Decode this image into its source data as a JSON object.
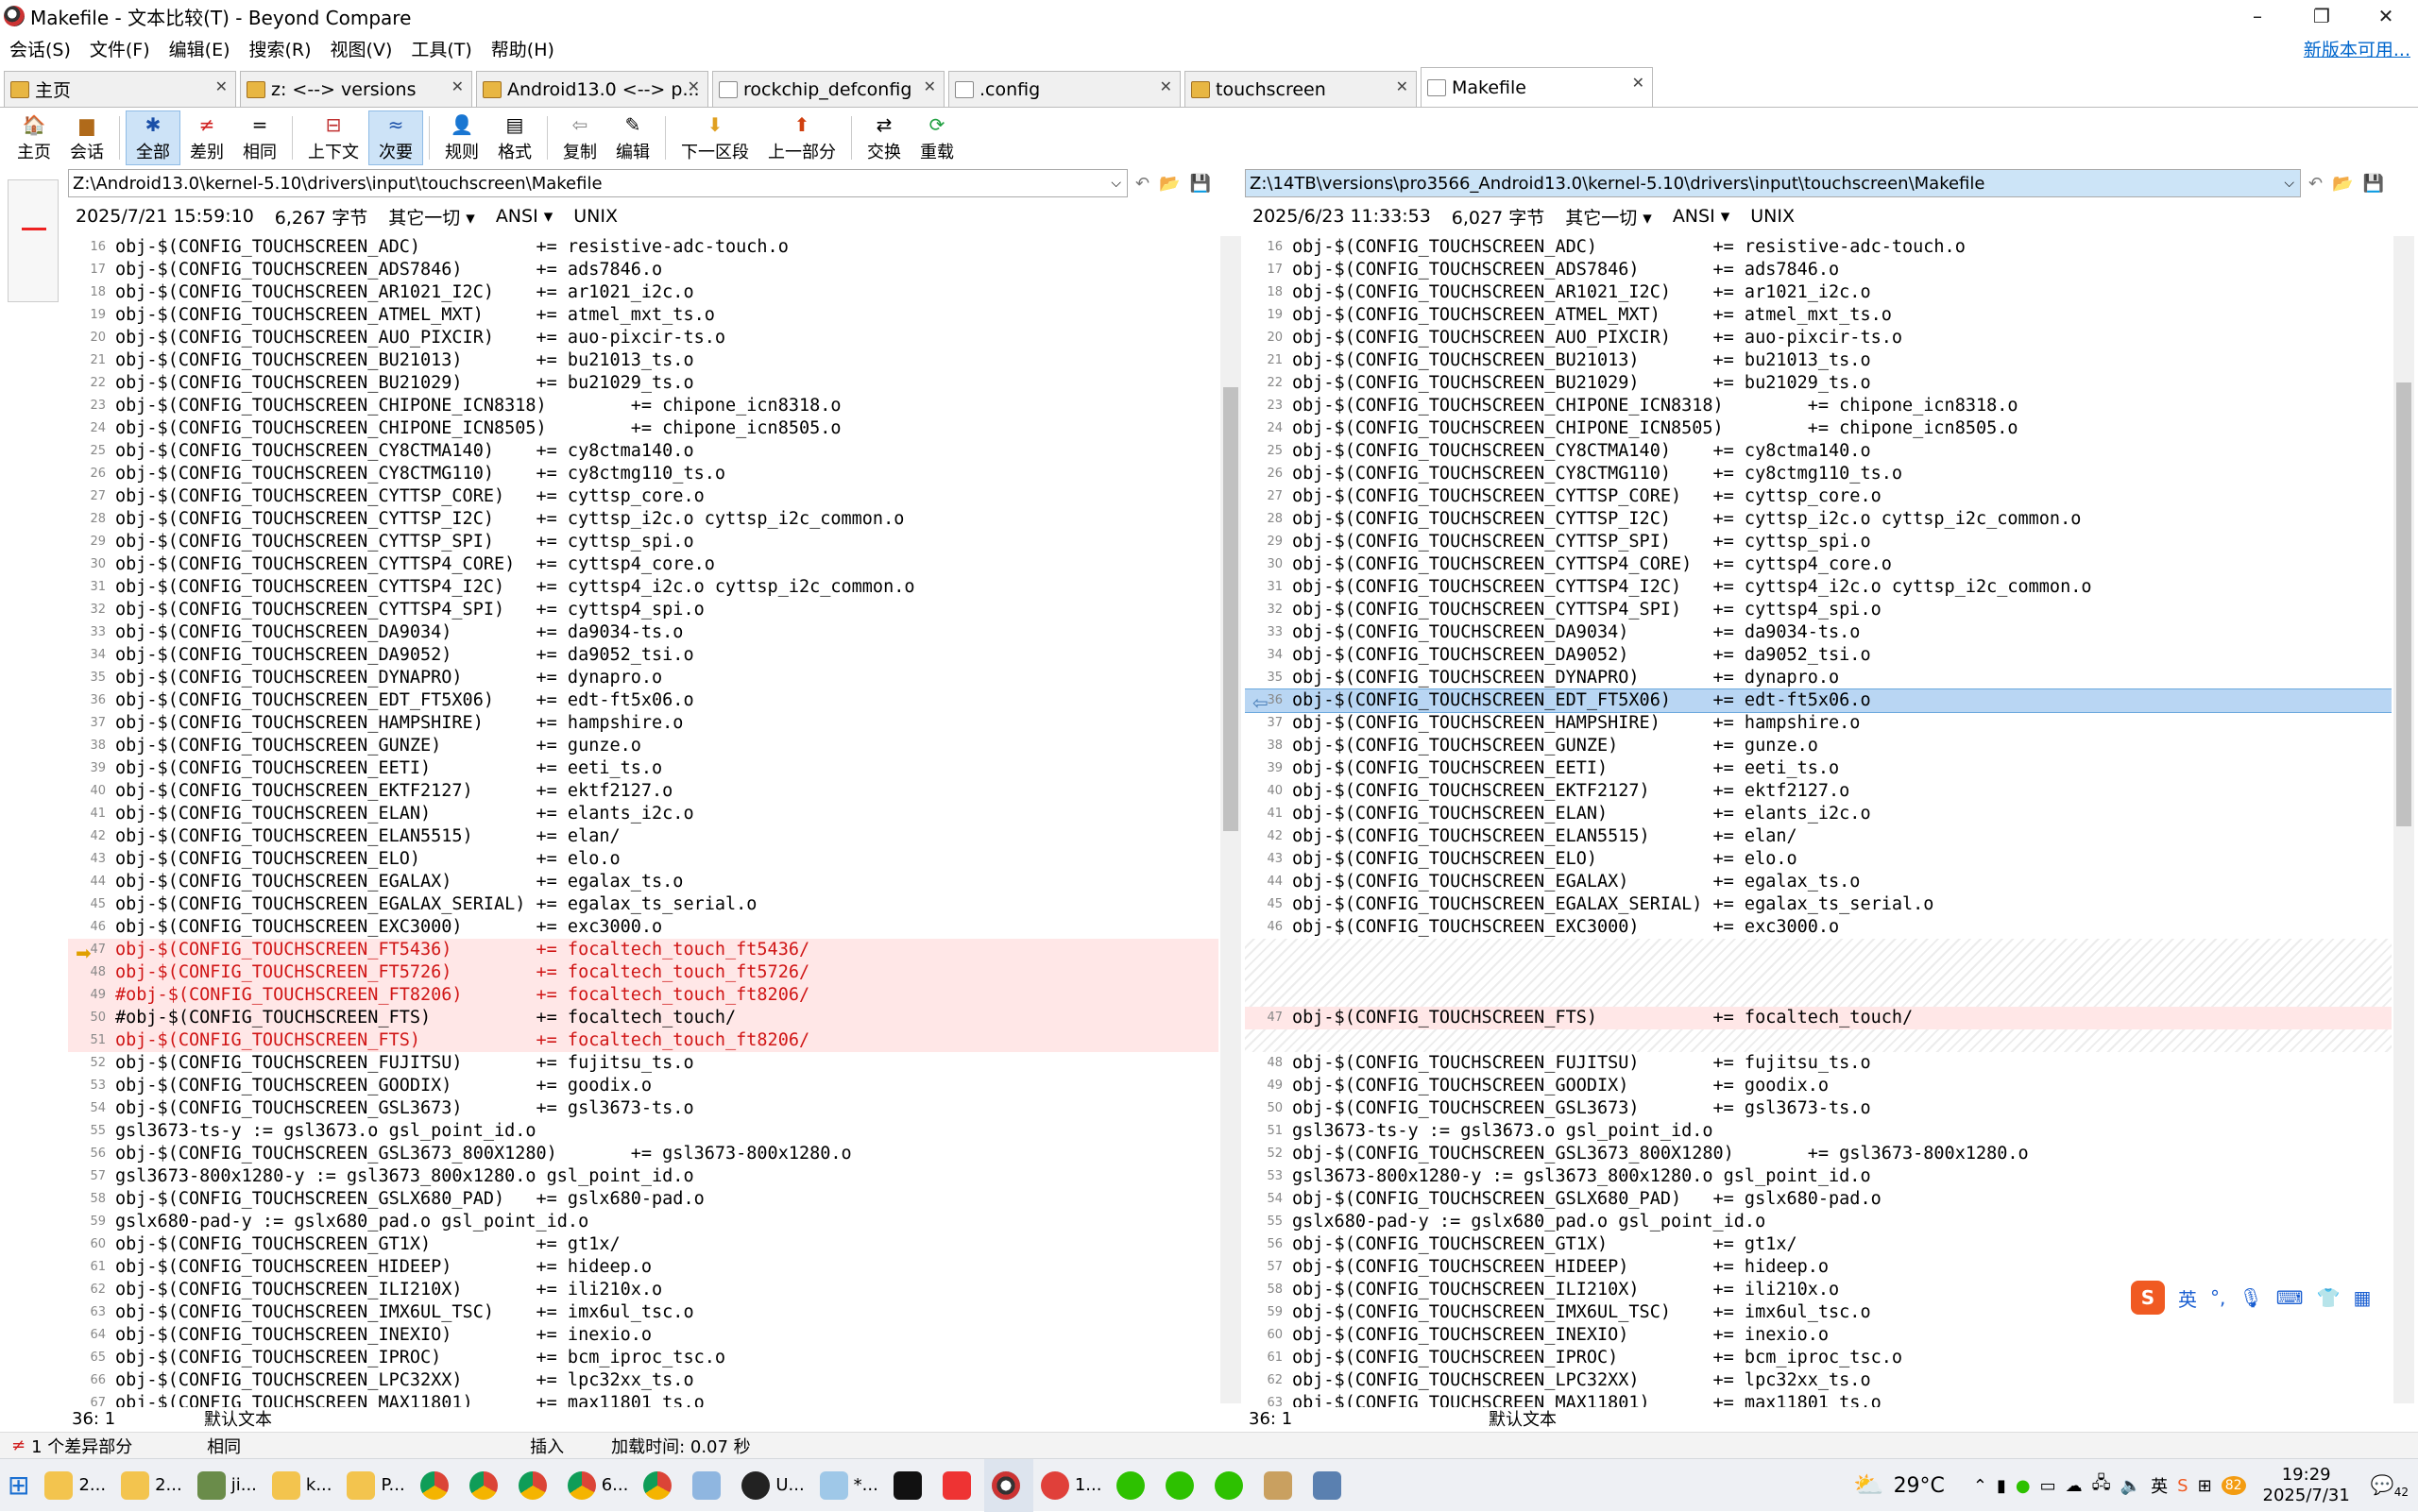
{
  "window": {
    "title": "Makefile - 文本比较(T) - Beyond Compare",
    "min": "–",
    "max": "❐",
    "close": "✕"
  },
  "menu": [
    "会话(S)",
    "文件(F)",
    "编辑(E)",
    "搜索(R)",
    "视图(V)",
    "工具(T)",
    "帮助(H)"
  ],
  "update_link": "新版本可用...",
  "tabs": [
    {
      "label": "主页"
    },
    {
      "label": "z: <--> versions"
    },
    {
      "label": "Android13.0 <--> p..."
    },
    {
      "label": "rockchip_defconfig"
    },
    {
      "label": ".config"
    },
    {
      "label": "touchscreen"
    },
    {
      "label": "Makefile"
    }
  ],
  "toolbar": {
    "home": "主页",
    "session": "会话",
    "all": "全部",
    "diff": "差别",
    "same": "相同",
    "context": "上下文",
    "minor": "次要",
    "rules": "规则",
    "format": "格式",
    "copy": "复制",
    "edit": "编辑",
    "next_section": "下一区段",
    "prev_part": "上一部分",
    "swap": "交换",
    "reload": "重载"
  },
  "left": {
    "path": "Z:\\Android13.0\\kernel-5.10\\drivers\\input\\touchscreen\\Makefile",
    "date": "2025/7/21 15:59:10",
    "size": "6,267 字节",
    "other": "其它一切 ▾",
    "enc": "ANSI ▾",
    "eol": "UNIX",
    "pos": "36: 1",
    "texttype": "默认文本"
  },
  "right": {
    "path": "Z:\\14TB\\versions\\pro3566_Android13.0\\kernel-5.10\\drivers\\input\\touchscreen\\Makefile",
    "date": "2025/6/23 11:33:53",
    "size": "6,027 字节",
    "other": "其它一切 ▾",
    "enc": "ANSI ▾",
    "eol": "UNIX",
    "pos": "36: 1",
    "texttype": "默认文本"
  },
  "left_lines": [
    {
      "n": "16",
      "t": "obj-$(CONFIG_TOUCHSCREEN_ADC)           += resistive-adc-touch.o"
    },
    {
      "n": "17",
      "t": "obj-$(CONFIG_TOUCHSCREEN_ADS7846)       += ads7846.o"
    },
    {
      "n": "18",
      "t": "obj-$(CONFIG_TOUCHSCREEN_AR1021_I2C)    += ar1021_i2c.o"
    },
    {
      "n": "19",
      "t": "obj-$(CONFIG_TOUCHSCREEN_ATMEL_MXT)     += atmel_mxt_ts.o"
    },
    {
      "n": "20",
      "t": "obj-$(CONFIG_TOUCHSCREEN_AUO_PIXCIR)    += auo-pixcir-ts.o"
    },
    {
      "n": "21",
      "t": "obj-$(CONFIG_TOUCHSCREEN_BU21013)       += bu21013_ts.o"
    },
    {
      "n": "22",
      "t": "obj-$(CONFIG_TOUCHSCREEN_BU21029)       += bu21029_ts.o"
    },
    {
      "n": "23",
      "t": "obj-$(CONFIG_TOUCHSCREEN_CHIPONE_ICN8318)        += chipone_icn8318.o"
    },
    {
      "n": "24",
      "t": "obj-$(CONFIG_TOUCHSCREEN_CHIPONE_ICN8505)        += chipone_icn8505.o"
    },
    {
      "n": "25",
      "t": "obj-$(CONFIG_TOUCHSCREEN_CY8CTMA140)    += cy8ctma140.o"
    },
    {
      "n": "26",
      "t": "obj-$(CONFIG_TOUCHSCREEN_CY8CTMG110)    += cy8ctmg110_ts.o"
    },
    {
      "n": "27",
      "t": "obj-$(CONFIG_TOUCHSCREEN_CYTTSP_CORE)   += cyttsp_core.o"
    },
    {
      "n": "28",
      "t": "obj-$(CONFIG_TOUCHSCREEN_CYTTSP_I2C)    += cyttsp_i2c.o cyttsp_i2c_common.o"
    },
    {
      "n": "29",
      "t": "obj-$(CONFIG_TOUCHSCREEN_CYTTSP_SPI)    += cyttsp_spi.o"
    },
    {
      "n": "30",
      "t": "obj-$(CONFIG_TOUCHSCREEN_CYTTSP4_CORE)  += cyttsp4_core.o"
    },
    {
      "n": "31",
      "t": "obj-$(CONFIG_TOUCHSCREEN_CYTTSP4_I2C)   += cyttsp4_i2c.o cyttsp_i2c_common.o"
    },
    {
      "n": "32",
      "t": "obj-$(CONFIG_TOUCHSCREEN_CYTTSP4_SPI)   += cyttsp4_spi.o"
    },
    {
      "n": "33",
      "t": "obj-$(CONFIG_TOUCHSCREEN_DA9034)        += da9034-ts.o"
    },
    {
      "n": "34",
      "t": "obj-$(CONFIG_TOUCHSCREEN_DA9052)        += da9052_tsi.o"
    },
    {
      "n": "35",
      "t": "obj-$(CONFIG_TOUCHSCREEN_DYNAPRO)       += dynapro.o"
    },
    {
      "n": "36",
      "t": "obj-$(CONFIG_TOUCHSCREEN_EDT_FT5X06)    += edt-ft5x06.o"
    },
    {
      "n": "37",
      "t": "obj-$(CONFIG_TOUCHSCREEN_HAMPSHIRE)     += hampshire.o"
    },
    {
      "n": "38",
      "t": "obj-$(CONFIG_TOUCHSCREEN_GUNZE)         += gunze.o"
    },
    {
      "n": "39",
      "t": "obj-$(CONFIG_TOUCHSCREEN_EETI)          += eeti_ts.o"
    },
    {
      "n": "40",
      "t": "obj-$(CONFIG_TOUCHSCREEN_EKTF2127)      += ektf2127.o"
    },
    {
      "n": "41",
      "t": "obj-$(CONFIG_TOUCHSCREEN_ELAN)          += elants_i2c.o"
    },
    {
      "n": "42",
      "t": "obj-$(CONFIG_TOUCHSCREEN_ELAN5515)      += elan/"
    },
    {
      "n": "43",
      "t": "obj-$(CONFIG_TOUCHSCREEN_ELO)           += elo.o"
    },
    {
      "n": "44",
      "t": "obj-$(CONFIG_TOUCHSCREEN_EGALAX)        += egalax_ts.o"
    },
    {
      "n": "45",
      "t": "obj-$(CONFIG_TOUCHSCREEN_EGALAX_SERIAL) += egalax_ts_serial.o"
    },
    {
      "n": "46",
      "t": "obj-$(CONFIG_TOUCHSCREEN_EXC3000)       += exc3000.o"
    },
    {
      "n": "47",
      "t": "obj-$(CONFIG_TOUCHSCREEN_FT5436)        += focaltech_touch_ft5436/",
      "d": "red"
    },
    {
      "n": "48",
      "t": "obj-$(CONFIG_TOUCHSCREEN_FT5726)        += focaltech_touch_ft5726/",
      "d": "red"
    },
    {
      "n": "49",
      "t": "#obj-$(CONFIG_TOUCHSCREEN_FT8206)       += focaltech_touch_ft8206/",
      "d": "red"
    },
    {
      "n": "50",
      "t": "#obj-$(CONFIG_TOUCHSCREEN_FTS)          += focaltech_touch/",
      "d": "mix"
    },
    {
      "n": "51",
      "t": "obj-$(CONFIG_TOUCHSCREEN_FTS)           += focaltech_touch_ft8206/",
      "d": "red"
    },
    {
      "n": "52",
      "t": "obj-$(CONFIG_TOUCHSCREEN_FUJITSU)       += fujitsu_ts.o"
    },
    {
      "n": "53",
      "t": "obj-$(CONFIG_TOUCHSCREEN_GOODIX)        += goodix.o"
    },
    {
      "n": "54",
      "t": "obj-$(CONFIG_TOUCHSCREEN_GSL3673)       += gsl3673-ts.o"
    },
    {
      "n": "55",
      "t": "gsl3673-ts-y := gsl3673.o gsl_point_id.o"
    },
    {
      "n": "56",
      "t": "obj-$(CONFIG_TOUCHSCREEN_GSL3673_800X1280)       += gsl3673-800x1280.o"
    },
    {
      "n": "57",
      "t": "gsl3673-800x1280-y := gsl3673_800x1280.o gsl_point_id.o"
    },
    {
      "n": "58",
      "t": "obj-$(CONFIG_TOUCHSCREEN_GSLX680_PAD)   += gslx680-pad.o"
    },
    {
      "n": "59",
      "t": "gslx680-pad-y := gslx680_pad.o gsl_point_id.o"
    },
    {
      "n": "60",
      "t": "obj-$(CONFIG_TOUCHSCREEN_GT1X)          += gt1x/"
    },
    {
      "n": "61",
      "t": "obj-$(CONFIG_TOUCHSCREEN_HIDEEP)        += hideep.o"
    },
    {
      "n": "62",
      "t": "obj-$(CONFIG_TOUCHSCREEN_ILI210X)       += ili210x.o"
    },
    {
      "n": "63",
      "t": "obj-$(CONFIG_TOUCHSCREEN_IMX6UL_TSC)    += imx6ul_tsc.o"
    },
    {
      "n": "64",
      "t": "obj-$(CONFIG_TOUCHSCREEN_INEXIO)        += inexio.o"
    },
    {
      "n": "65",
      "t": "obj-$(CONFIG_TOUCHSCREEN_IPROC)         += bcm_iproc_tsc.o"
    },
    {
      "n": "66",
      "t": "obj-$(CONFIG_TOUCHSCREEN_LPC32XX)       += lpc32xx_ts.o"
    },
    {
      "n": "67",
      "t": "obj-$(CONFIG_TOUCHSCREEN_MAX11801)      += max11801_ts.o"
    }
  ],
  "right_lines_a": [
    {
      "n": "16",
      "t": "obj-$(CONFIG_TOUCHSCREEN_ADC)           += resistive-adc-touch.o"
    },
    {
      "n": "17",
      "t": "obj-$(CONFIG_TOUCHSCREEN_ADS7846)       += ads7846.o"
    },
    {
      "n": "18",
      "t": "obj-$(CONFIG_TOUCHSCREEN_AR1021_I2C)    += ar1021_i2c.o"
    },
    {
      "n": "19",
      "t": "obj-$(CONFIG_TOUCHSCREEN_ATMEL_MXT)     += atmel_mxt_ts.o"
    },
    {
      "n": "20",
      "t": "obj-$(CONFIG_TOUCHSCREEN_AUO_PIXCIR)    += auo-pixcir-ts.o"
    },
    {
      "n": "21",
      "t": "obj-$(CONFIG_TOUCHSCREEN_BU21013)       += bu21013_ts.o"
    },
    {
      "n": "22",
      "t": "obj-$(CONFIG_TOUCHSCREEN_BU21029)       += bu21029_ts.o"
    },
    {
      "n": "23",
      "t": "obj-$(CONFIG_TOUCHSCREEN_CHIPONE_ICN8318)        += chipone_icn8318.o"
    },
    {
      "n": "24",
      "t": "obj-$(CONFIG_TOUCHSCREEN_CHIPONE_ICN8505)        += chipone_icn8505.o"
    },
    {
      "n": "25",
      "t": "obj-$(CONFIG_TOUCHSCREEN_CY8CTMA140)    += cy8ctma140.o"
    },
    {
      "n": "26",
      "t": "obj-$(CONFIG_TOUCHSCREEN_CY8CTMG110)    += cy8ctmg110_ts.o"
    },
    {
      "n": "27",
      "t": "obj-$(CONFIG_TOUCHSCREEN_CYTTSP_CORE)   += cyttsp_core.o"
    },
    {
      "n": "28",
      "t": "obj-$(CONFIG_TOUCHSCREEN_CYTTSP_I2C)    += cyttsp_i2c.o cyttsp_i2c_common.o"
    },
    {
      "n": "29",
      "t": "obj-$(CONFIG_TOUCHSCREEN_CYTTSP_SPI)    += cyttsp_spi.o"
    },
    {
      "n": "30",
      "t": "obj-$(CONFIG_TOUCHSCREEN_CYTTSP4_CORE)  += cyttsp4_core.o"
    },
    {
      "n": "31",
      "t": "obj-$(CONFIG_TOUCHSCREEN_CYTTSP4_I2C)   += cyttsp4_i2c.o cyttsp_i2c_common.o"
    },
    {
      "n": "32",
      "t": "obj-$(CONFIG_TOUCHSCREEN_CYTTSP4_SPI)   += cyttsp4_spi.o"
    },
    {
      "n": "33",
      "t": "obj-$(CONFIG_TOUCHSCREEN_DA9034)        += da9034-ts.o"
    },
    {
      "n": "34",
      "t": "obj-$(CONFIG_TOUCHSCREEN_DA9052)        += da9052_tsi.o"
    },
    {
      "n": "35",
      "t": "obj-$(CONFIG_TOUCHSCREEN_DYNAPRO)       += dynapro.o"
    },
    {
      "n": "36",
      "t": "obj-$(CONFIG_TOUCHSCREEN_EDT_FT5X06)    += edt-ft5x06.o",
      "d": "sel"
    },
    {
      "n": "37",
      "t": "obj-$(CONFIG_TOUCHSCREEN_HAMPSHIRE)     += hampshire.o"
    },
    {
      "n": "38",
      "t": "obj-$(CONFIG_TOUCHSCREEN_GUNZE)         += gunze.o"
    },
    {
      "n": "39",
      "t": "obj-$(CONFIG_TOUCHSCREEN_EETI)          += eeti_ts.o"
    },
    {
      "n": "40",
      "t": "obj-$(CONFIG_TOUCHSCREEN_EKTF2127)      += ektf2127.o"
    },
    {
      "n": "41",
      "t": "obj-$(CONFIG_TOUCHSCREEN_ELAN)          += elants_i2c.o"
    },
    {
      "n": "42",
      "t": "obj-$(CONFIG_TOUCHSCREEN_ELAN5515)      += elan/"
    },
    {
      "n": "43",
      "t": "obj-$(CONFIG_TOUCHSCREEN_ELO)           += elo.o"
    },
    {
      "n": "44",
      "t": "obj-$(CONFIG_TOUCHSCREEN_EGALAX)        += egalax_ts.o"
    },
    {
      "n": "45",
      "t": "obj-$(CONFIG_TOUCHSCREEN_EGALAX_SERIAL) += egalax_ts_serial.o"
    },
    {
      "n": "46",
      "t": "obj-$(CONFIG_TOUCHSCREEN_EXC3000)       += exc3000.o"
    }
  ],
  "right_line_diff": {
    "n": "47",
    "t": "obj-$(CONFIG_TOUCHSCREEN_FTS)           += focaltech_touch/"
  },
  "right_lines_b": [
    {
      "n": "48",
      "t": "obj-$(CONFIG_TOUCHSCREEN_FUJITSU)       += fujitsu_ts.o"
    },
    {
      "n": "49",
      "t": "obj-$(CONFIG_TOUCHSCREEN_GOODIX)        += goodix.o"
    },
    {
      "n": "50",
      "t": "obj-$(CONFIG_TOUCHSCREEN_GSL3673)       += gsl3673-ts.o"
    },
    {
      "n": "51",
      "t": "gsl3673-ts-y := gsl3673.o gsl_point_id.o"
    },
    {
      "n": "52",
      "t": "obj-$(CONFIG_TOUCHSCREEN_GSL3673_800X1280)       += gsl3673-800x1280.o"
    },
    {
      "n": "53",
      "t": "gsl3673-800x1280-y := gsl3673_800x1280.o gsl_point_id.o"
    },
    {
      "n": "54",
      "t": "obj-$(CONFIG_TOUCHSCREEN_GSLX680_PAD)   += gslx680-pad.o"
    },
    {
      "n": "55",
      "t": "gslx680-pad-y := gslx680_pad.o gsl_point_id.o"
    },
    {
      "n": "56",
      "t": "obj-$(CONFIG_TOUCHSCREEN_GT1X)          += gt1x/"
    },
    {
      "n": "57",
      "t": "obj-$(CONFIG_TOUCHSCREEN_HIDEEP)        += hideep.o"
    },
    {
      "n": "58",
      "t": "obj-$(CONFIG_TOUCHSCREEN_ILI210X)       += ili210x.o"
    },
    {
      "n": "59",
      "t": "obj-$(CONFIG_TOUCHSCREEN_IMX6UL_TSC)    += imx6ul_tsc.o"
    },
    {
      "n": "60",
      "t": "obj-$(CONFIG_TOUCHSCREEN_INEXIO)        += inexio.o"
    },
    {
      "n": "61",
      "t": "obj-$(CONFIG_TOUCHSCREEN_IPROC)         += bcm_iproc_tsc.o"
    },
    {
      "n": "62",
      "t": "obj-$(CONFIG_TOUCHSCREEN_LPC32XX)       += lpc32xx_ts.o"
    },
    {
      "n": "63",
      "t": "obj-$(CONFIG_TOUCHSCREEN_MAX11801)      += max11801_ts.o"
    }
  ],
  "status": {
    "diffs": "1 个差异部分",
    "same": "相同",
    "insert": "插入",
    "load": "加载时间: 0.07 秒"
  },
  "taskbar": {
    "items": [
      "2...",
      "2...",
      "ji...",
      "k...",
      "P...",
      "6...",
      "U...",
      "*...",
      "1..."
    ],
    "weather": "29°C",
    "time": "19:29",
    "date": "2025/7/31",
    "notif": "42",
    "ime_lang": "英"
  },
  "colors": {
    "diff_bg": "#ffe7e7",
    "diff_fg": "#d01515",
    "sel_bg": "#b9d6f3",
    "link": "#0066cc"
  }
}
